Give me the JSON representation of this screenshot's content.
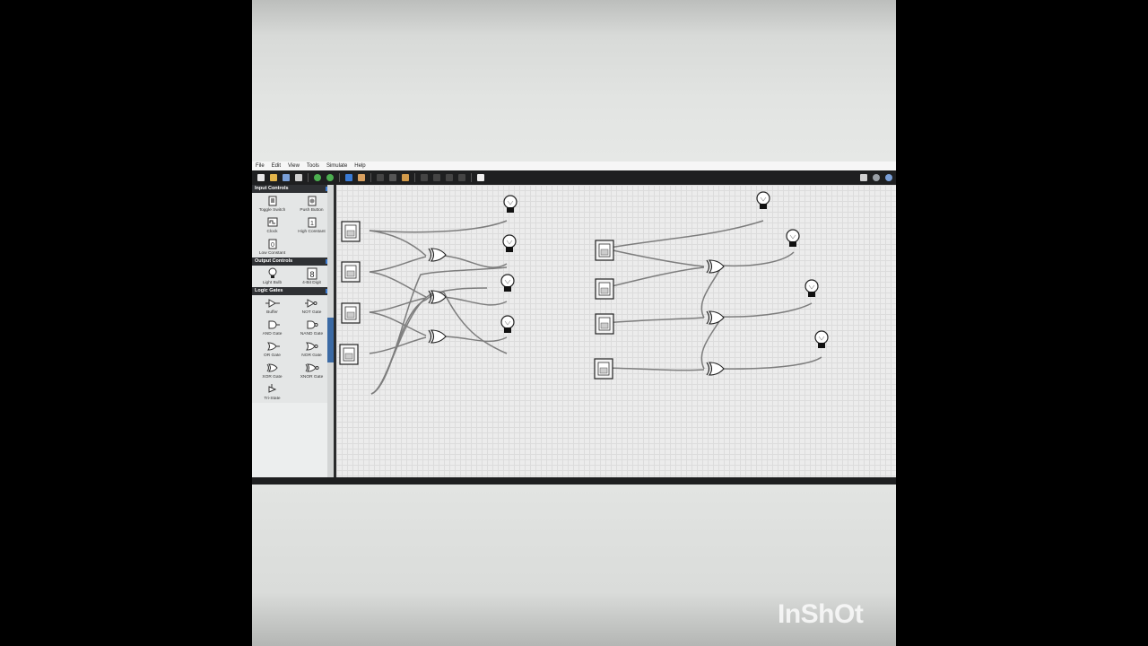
{
  "menu": [
    "File",
    "Edit",
    "View",
    "Tools",
    "Simulate",
    "Help"
  ],
  "toolbar_icons": [
    "new-icon",
    "open-icon",
    "save-icon",
    "print-icon",
    "undo-icon",
    "redo-icon",
    "select-icon",
    "pan-icon",
    "cut-icon",
    "copy-icon",
    "paste-icon",
    "delete-icon",
    "zoom-icon",
    "wire-icon",
    "settings-icon"
  ],
  "sidebar": {
    "input_controls": {
      "title": "Input Controls",
      "items": [
        "Toggle Switch",
        "Push Button",
        "Clock",
        "High Constant",
        "Low Constant"
      ]
    },
    "output_controls": {
      "title": "Output Controls",
      "items": [
        "Light Bulb",
        "4-Bit Digit"
      ]
    },
    "logic_gates": {
      "title": "Logic Gates",
      "items": [
        "Buffer",
        "NOT Gate",
        "AND Gate",
        "NAND Gate",
        "OR Gate",
        "NOR Gate",
        "XOR Gate",
        "XNOR Gate",
        "Tri-State"
      ]
    }
  },
  "watermark": "InShOt",
  "colors": {
    "toolbar": "#1e1f20",
    "accent": "#3a7bd5",
    "canvas": "#ececec",
    "wire": "#808080"
  }
}
